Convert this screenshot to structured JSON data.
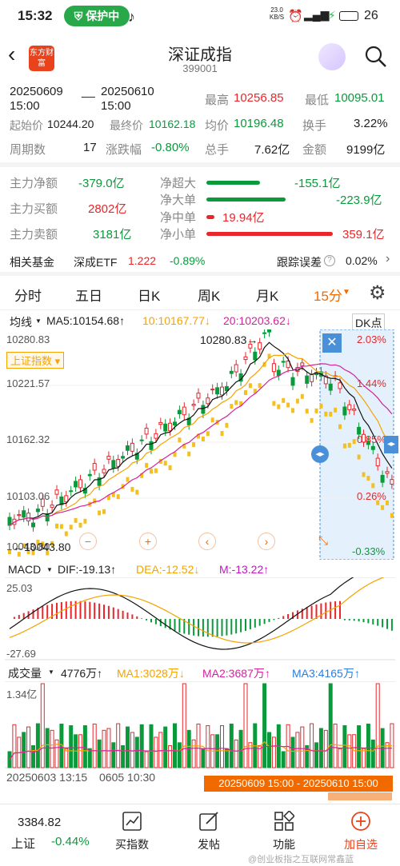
{
  "status": {
    "time": "15:32",
    "protect": "保护中",
    "net": "23.0\nKB/S",
    "battery": "26"
  },
  "nav": {
    "title": "深证成指",
    "code": "399001",
    "logo": "东方财富"
  },
  "info": {
    "range_start": "20250609",
    "range_start_time": "15:00",
    "range_sep": "__",
    "range_end": "20250610",
    "range_end_time": "15:00",
    "high_label": "最高",
    "high": "10256.85",
    "low_label": "最低",
    "low": "10095.01",
    "start_label": "起始价",
    "start": "10244.20",
    "end_label": "最终价",
    "end": "10162.18",
    "avg_label": "均价",
    "avg": "10196.48",
    "turn_label": "换手",
    "turn": "3.22%",
    "period_label": "周期数",
    "period": "17",
    "chg_label": "涨跌幅",
    "chg": "-0.80%",
    "vol_label": "总手",
    "vol": "7.62亿",
    "amt_label": "金额",
    "amt": "9199亿"
  },
  "flow": {
    "net_label": "主力净额",
    "net": "-379.0亿",
    "buy_label": "主力买额",
    "buy": "2802亿",
    "sell_label": "主力卖额",
    "sell": "3181亿",
    "super_label": "净超大",
    "super": "-155.1亿",
    "large_label": "净大单",
    "large": "-223.9亿",
    "mid_label": "净中单",
    "mid": "19.94亿",
    "small_label": "净小单",
    "small": "359.1亿",
    "super_frac": 0.35,
    "large_frac": 0.52,
    "mid_frac": 0.05,
    "small_frac": 0.83
  },
  "fund": {
    "label": "相关基金",
    "name": "深成ETF",
    "price": "1.222",
    "chg": "-0.89%",
    "track_label": "跟踪误差",
    "track": "0.02%"
  },
  "tabs": [
    "分时",
    "五日",
    "日K",
    "周K",
    "月K",
    "15分"
  ],
  "ma": {
    "label": "均线",
    "ma5": "MA5:10154.68↑",
    "ma10": "10:10167.77↓",
    "ma20": "20:10203.62↓",
    "dk": "DK点"
  },
  "kline": {
    "ymax": "10280.83",
    "y2": "10221.57",
    "y3": "10162.32",
    "y4": "10103.06",
    "ymin": "10043.80",
    "hi_marker": "10280.83",
    "lo_marker": "10043.80",
    "overlay": "上证指数",
    "pct_top": "2.03%",
    "pct_2": "1.44%",
    "pct_3": "0.85%",
    "pct_4": "0.26%",
    "pct_bottom": "-0.33%"
  },
  "macd": {
    "label": "MACD",
    "dif": "DIF:-19.13↑",
    "dea": "DEA:-12.52↓",
    "m": "M:-13.22↑",
    "top": "25.03",
    "bottom": "-27.69"
  },
  "volume": {
    "label": "成交量",
    "val": "4776万↑",
    "ma1": "MA1:3028万↓",
    "ma2": "MA2:3687万↑",
    "ma3": "MA3:4165万↑",
    "top": "1.34亿"
  },
  "timeaxis": {
    "left": "20250603 13:15",
    "mid": "0605 10:30",
    "range": "20250609 15:00 - 20250610 15:00"
  },
  "bottom": {
    "index_price": "3384.82",
    "index_name": "上证",
    "index_chg": "-0.44%",
    "buy": "买指数",
    "post": "发帖",
    "func": "功能",
    "add": "加自选"
  },
  "watermark": "@创业板指之互联网常鑫蓝"
}
